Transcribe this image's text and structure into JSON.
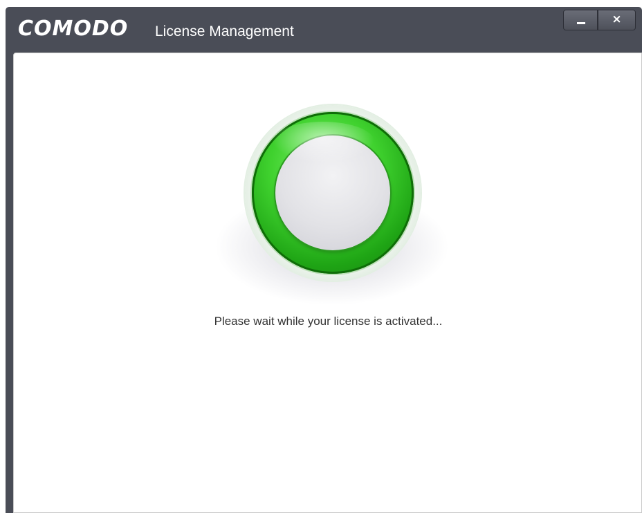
{
  "window": {
    "brand": "COMODO",
    "title": "License Management",
    "controls": {
      "minimize_glyph": "_",
      "close_glyph": "×"
    }
  },
  "main": {
    "status_text": "Please wait while your license is activated...",
    "spinner_icon": "activation-progress-ring-icon"
  },
  "colors": {
    "titlebar": "#4a4d57",
    "ring_green": "#2fbf1f",
    "content_bg": "#ffffff"
  }
}
